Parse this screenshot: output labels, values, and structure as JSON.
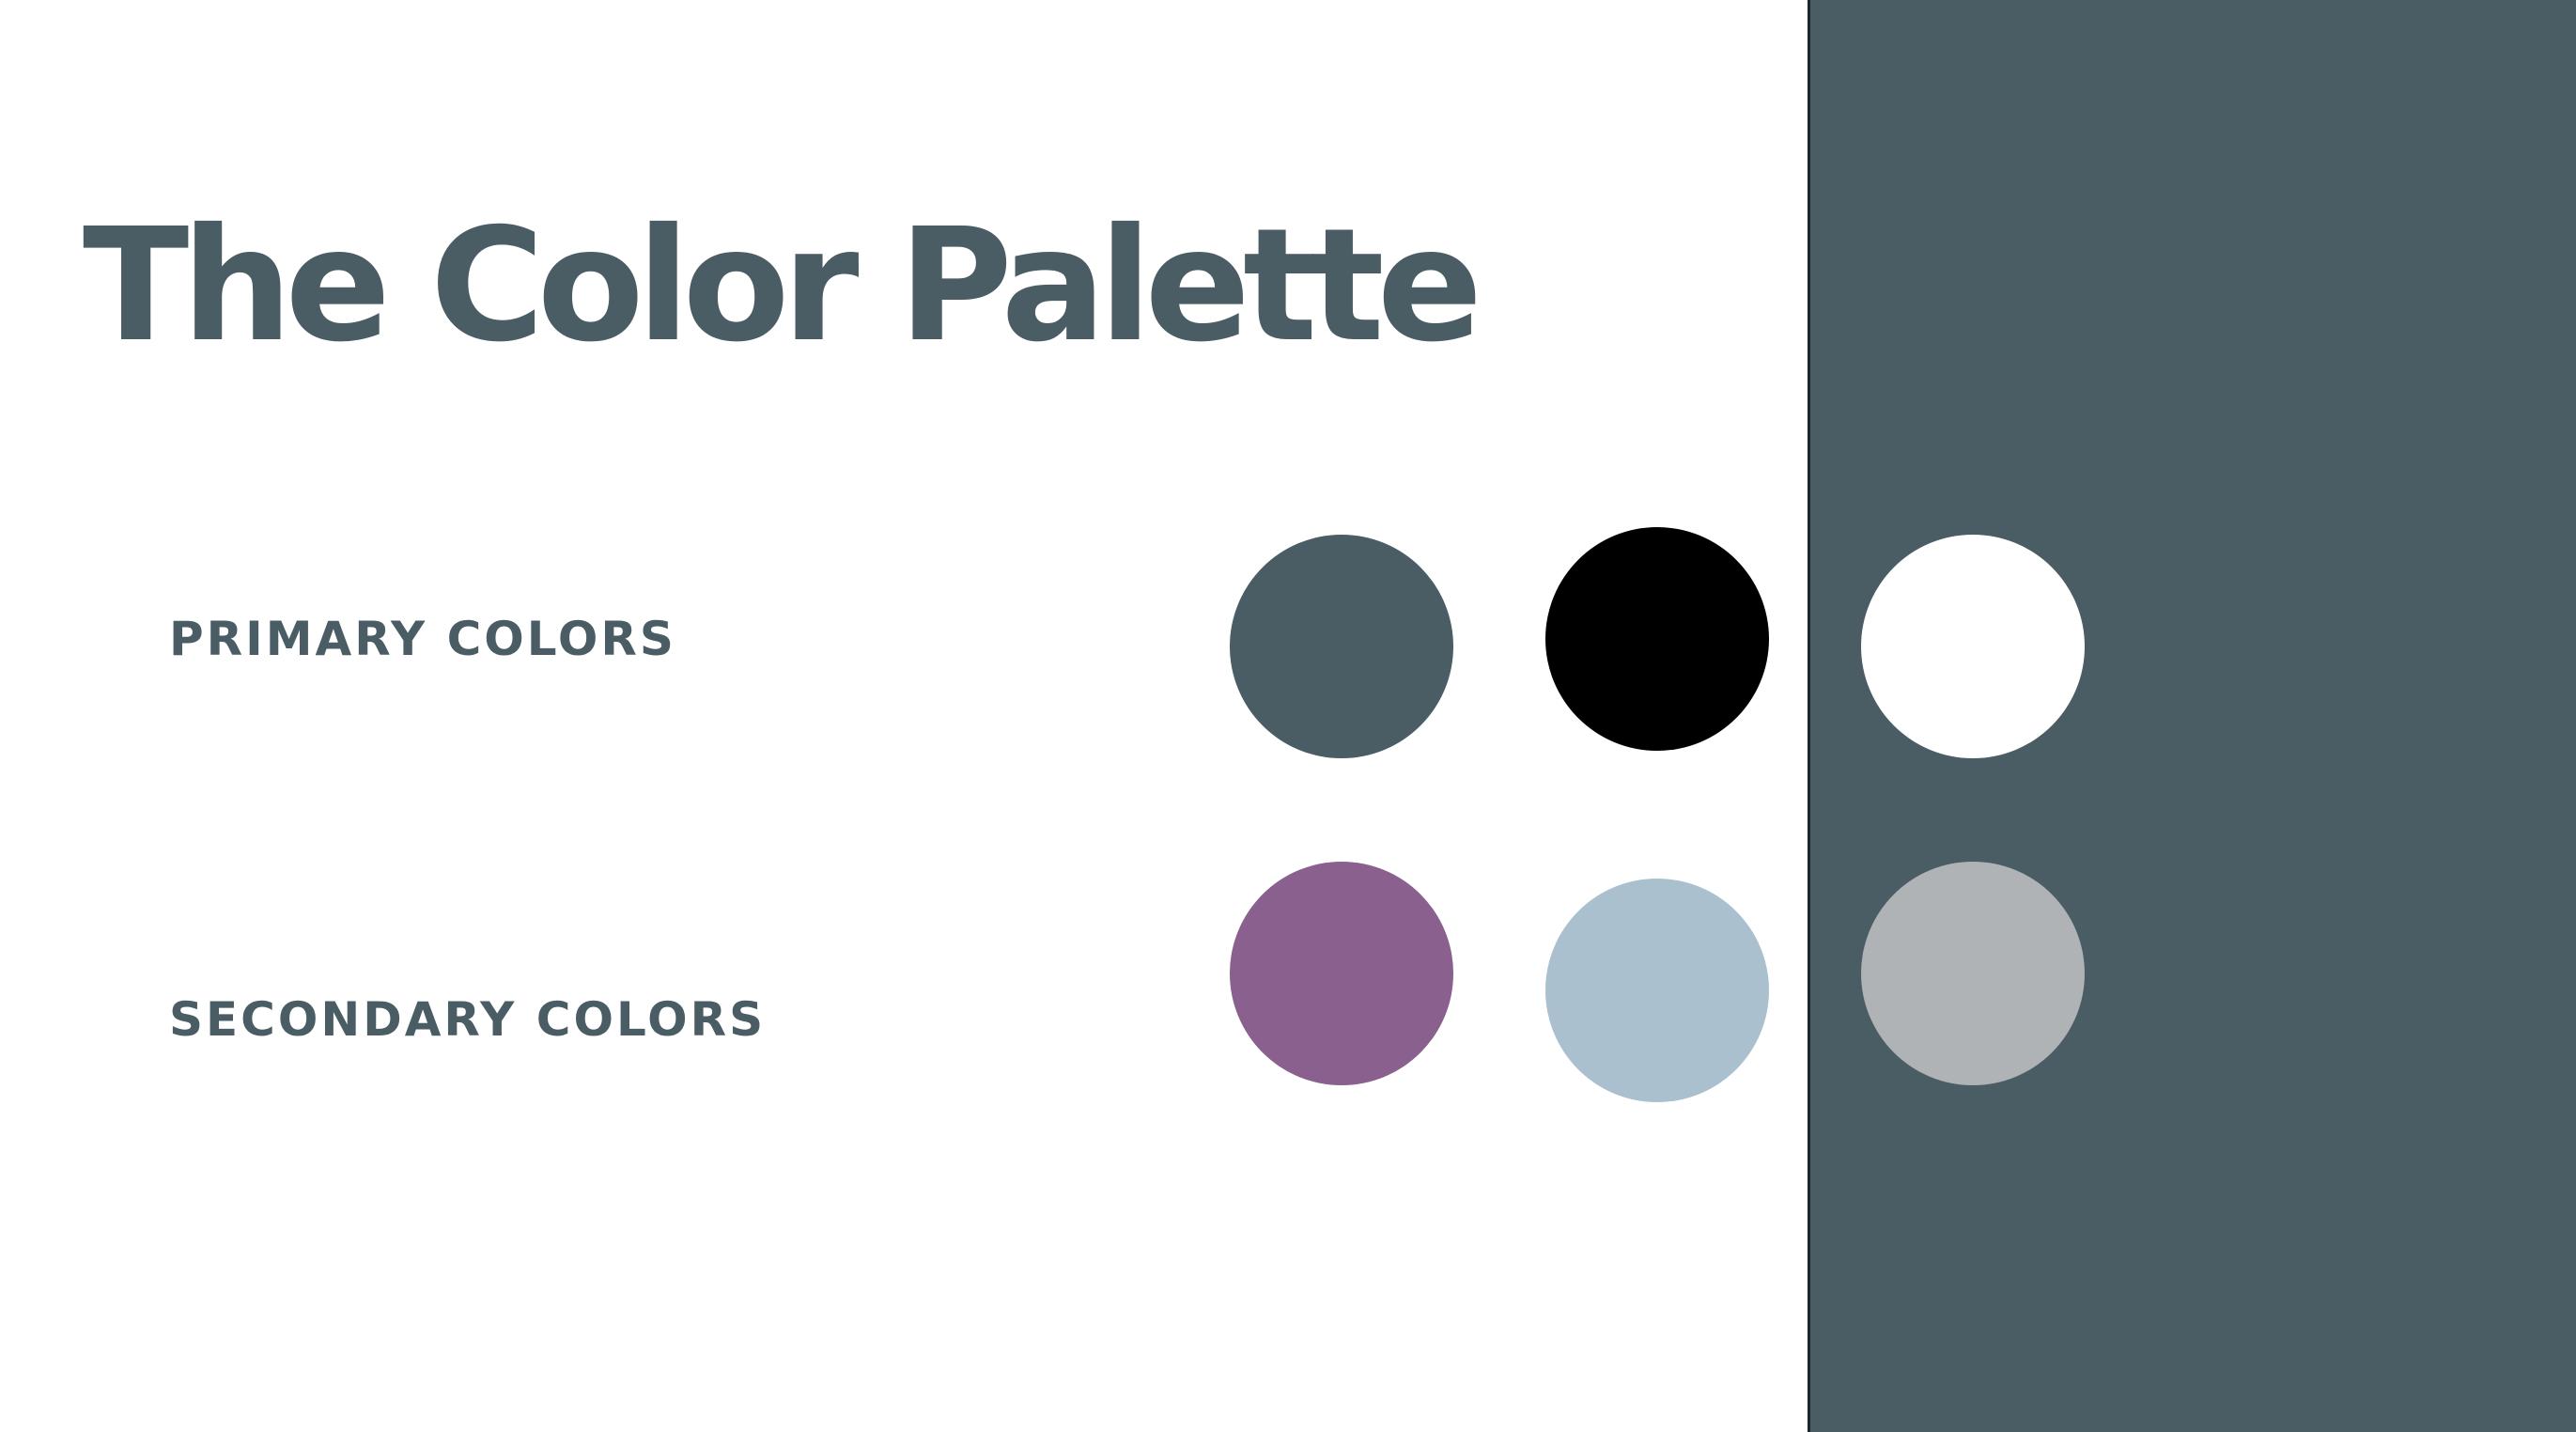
{
  "slide": {
    "title": "The Color Palette",
    "panel_color": "#4a5c64"
  },
  "primary": {
    "label": "PRIMARY COLORS",
    "swatches": [
      {
        "color": "#4a5c64"
      },
      {
        "color": "#000000"
      },
      {
        "color": "#ffffff"
      }
    ]
  },
  "secondary": {
    "label": "SECONDARY COLORS",
    "swatches": [
      {
        "color": "#89608e"
      },
      {
        "color": "#abc0cf"
      },
      {
        "color": "#afb3b6"
      }
    ]
  }
}
